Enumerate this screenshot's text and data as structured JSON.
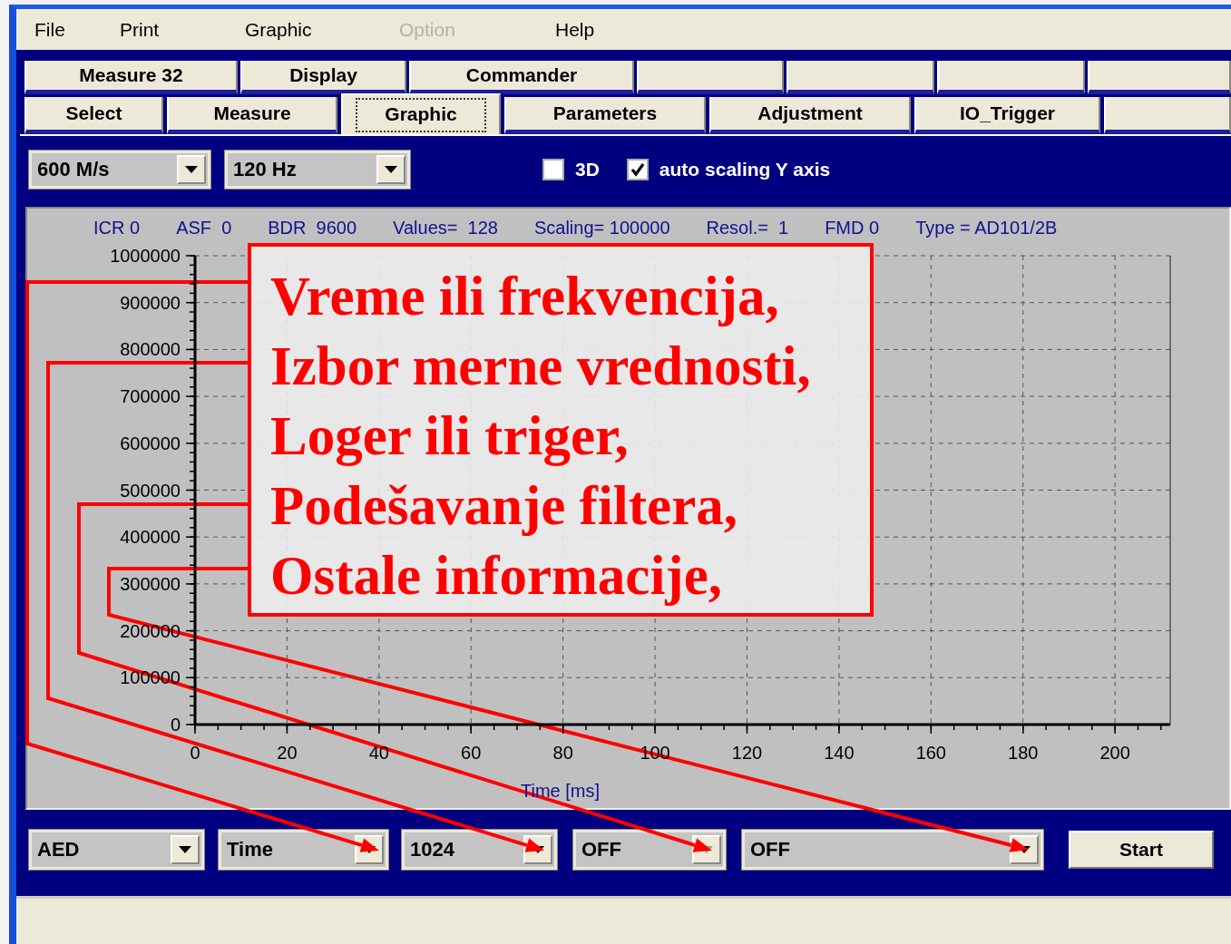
{
  "menu": [
    {
      "label": "File",
      "disabled": false
    },
    {
      "label": "Print",
      "disabled": false
    },
    {
      "label": "Graphic",
      "disabled": false
    },
    {
      "label": "Option",
      "disabled": true
    },
    {
      "label": "Help",
      "disabled": false
    }
  ],
  "tabs_top": [
    {
      "label": "Measure 32",
      "selected": false
    },
    {
      "label": "Display",
      "selected": false
    },
    {
      "label": "Commander",
      "selected": false
    },
    {
      "selected": false
    },
    {
      "selected": false
    },
    {
      "selected": false
    },
    {
      "selected": false
    }
  ],
  "tabs": [
    {
      "label": "Select",
      "selected": false
    },
    {
      "label": "Measure",
      "selected": false
    },
    {
      "label": "Graphic",
      "selected": true
    },
    {
      "label": "Parameters",
      "selected": false
    },
    {
      "label": "Adjustment",
      "selected": false
    },
    {
      "label": "IO_Trigger",
      "selected": false
    },
    {
      "selected": false
    }
  ],
  "toolbar": {
    "dropdowns": [
      {
        "value": "600 M/s"
      },
      {
        "value": "120  Hz"
      }
    ],
    "checkboxes": [
      {
        "label": "3D",
        "checked": false
      },
      {
        "label": "auto scaling Y axis",
        "checked": true
      }
    ]
  },
  "chart": {
    "info": [
      "ICR 0",
      "ASF  0",
      "BDR  9600",
      "Values=  128",
      "Scaling= 100000",
      "Resol.=  1",
      "FMD 0",
      "Type = AD101/2B"
    ],
    "chart_data": {
      "type": "line",
      "grid": true,
      "xlabel": "Time [ms]",
      "xlim": [
        0,
        212
      ],
      "ylim": [
        0,
        1000000
      ],
      "xticks": [
        0,
        20,
        40,
        60,
        80,
        100,
        120,
        140,
        160,
        180,
        200
      ],
      "yticks": [
        0,
        100000,
        200000,
        300000,
        400000,
        500000,
        600000,
        700000,
        800000,
        900000,
        1000000
      ]
    }
  },
  "bottom_bar": {
    "dropdowns": [
      {
        "value": "AED",
        "disabled": false
      },
      {
        "value": "Time",
        "disabled": false
      },
      {
        "value": "1024",
        "disabled": false
      },
      {
        "value": "OFF",
        "disabled": true
      },
      {
        "value": "OFF",
        "disabled": false
      }
    ],
    "button": "Start"
  },
  "annotation": {
    "lines": [
      "Vreme ili frekvencija,",
      "Izbor merne vrednosti,",
      "Loger ili triger,",
      "Podešavanje filtera,",
      "Ostale informacije,"
    ]
  }
}
